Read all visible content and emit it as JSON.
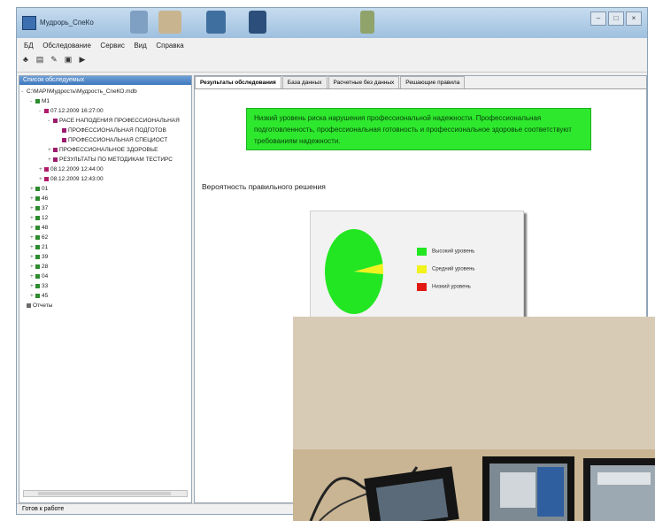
{
  "window": {
    "title": "Мудрорь_СпеКо"
  },
  "menu": [
    "БД",
    "Обследование",
    "Сервис",
    "Вид",
    "Справка"
  ],
  "left_panel": {
    "header": "Список обследуемых",
    "tree": [
      {
        "label": "С:\\MAPI\\Мудрость\\Мудрость_СпеКО.mdb",
        "indent": 0,
        "toggle": "-",
        "icon": ""
      },
      {
        "label": "M1",
        "indent": 1,
        "toggle": "-",
        "icon": "person"
      },
      {
        "label": "07.12.2009 16:27:00",
        "indent": 2,
        "toggle": "-",
        "icon": "flag"
      },
      {
        "label": "РАСЕ НАПОДЕНИЯ ПРОФЕССИОНАЛЬНАЯ",
        "indent": 3,
        "toggle": "-",
        "icon": "item"
      },
      {
        "label": "ПРОФЕССИОНАЛЬНАЯ ПОДГОТОВ",
        "indent": 4,
        "toggle": "",
        "icon": "item"
      },
      {
        "label": "ПРОФЕССИОНАЛЬНАЯ СПЕЦИОСТ",
        "indent": 4,
        "toggle": "",
        "icon": "item"
      },
      {
        "label": "ПРОФЕССИОНАЛЬНОЕ ЗДОРОВЬЕ",
        "indent": 3,
        "toggle": "+",
        "icon": "item"
      },
      {
        "label": "РЕЗУЛЬТАТЫ ПО МЕТОДИКАМ ТЕСТИРС",
        "indent": 3,
        "toggle": "+",
        "icon": "item"
      },
      {
        "label": "08.12.2009 12:44:00",
        "indent": 2,
        "toggle": "+",
        "icon": "flag"
      },
      {
        "label": "08.12.2009 12:43:00",
        "indent": 2,
        "toggle": "+",
        "icon": "flag"
      },
      {
        "label": "01",
        "indent": 1,
        "toggle": "+",
        "icon": "person"
      },
      {
        "label": "46",
        "indent": 1,
        "toggle": "+",
        "icon": "person"
      },
      {
        "label": "37",
        "indent": 1,
        "toggle": "+",
        "icon": "person"
      },
      {
        "label": "12",
        "indent": 1,
        "toggle": "+",
        "icon": "person"
      },
      {
        "label": "48",
        "indent": 1,
        "toggle": "+",
        "icon": "person"
      },
      {
        "label": "62",
        "indent": 1,
        "toggle": "+",
        "icon": "person"
      },
      {
        "label": "21",
        "indent": 1,
        "toggle": "+",
        "icon": "person"
      },
      {
        "label": "39",
        "indent": 1,
        "toggle": "+",
        "icon": "person"
      },
      {
        "label": "28",
        "indent": 1,
        "toggle": "+",
        "icon": "person"
      },
      {
        "label": "04",
        "indent": 1,
        "toggle": "+",
        "icon": "person"
      },
      {
        "label": "33",
        "indent": 1,
        "toggle": "+",
        "icon": "person"
      },
      {
        "label": "45",
        "indent": 1,
        "toggle": "+",
        "icon": "person"
      },
      {
        "label": "Отчеты",
        "indent": 0,
        "toggle": "",
        "icon": "folder"
      }
    ]
  },
  "tabs": [
    "Результаты обследования",
    "База данных",
    "Расчетные без данных",
    "Решающие правила"
  ],
  "result_text": "Низкий уровень риска нарушения профессиональной надежности. Профессиональная подготовленность, профессиональная готовность и профессиональное здоровье соответствуют требованиям надежности.",
  "probability_label": "Вероятность правильного решения",
  "chart_data": {
    "type": "pie",
    "values": [
      96,
      4,
      0
    ],
    "labels": [
      "Высокий уровень",
      "Средний уровень",
      "Низкий уровень"
    ],
    "colors": [
      "#22e622",
      "#f2f21c",
      "#e01a12"
    ],
    "legend_position": "right"
  },
  "status": "Готов к работе",
  "colors": {
    "result_bg": "#2ee82e",
    "title_bar": "#a9c8e6"
  }
}
